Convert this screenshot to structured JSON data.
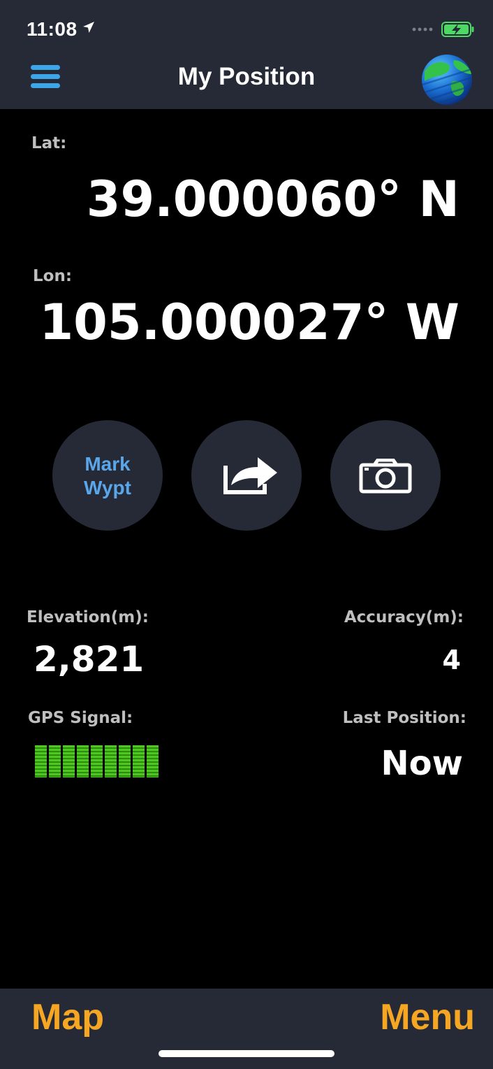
{
  "status": {
    "time": "11:08",
    "battery_color": "#4cd964"
  },
  "nav": {
    "title": "My Position",
    "menu_icon": "hamburger-icon",
    "globe_icon": "globe-icon"
  },
  "position": {
    "lat_label": "Lat:",
    "lat_value": "39.000060° N",
    "lon_label": "Lon:",
    "lon_value": "105.000027° W"
  },
  "actions": {
    "mark_line1": "Mark",
    "mark_line2": "Wypt",
    "share_icon": "share-icon",
    "camera_icon": "camera-icon"
  },
  "stats": {
    "elevation_label": "Elevation(m):",
    "elevation_value": "2,821",
    "accuracy_label": "Accuracy(m):",
    "accuracy_value": "4",
    "gps_label": "GPS Signal:",
    "gps_bar_count": 9,
    "last_position_label": "Last Position:",
    "last_position_value": "Now"
  },
  "bottom": {
    "map_label": "Map",
    "menu_label": "Menu"
  },
  "colors": {
    "accent_blue": "#3da6e8",
    "accent_orange": "#f5a623",
    "bar_bg": "#252a36",
    "gps_green": "#4cc81e"
  }
}
